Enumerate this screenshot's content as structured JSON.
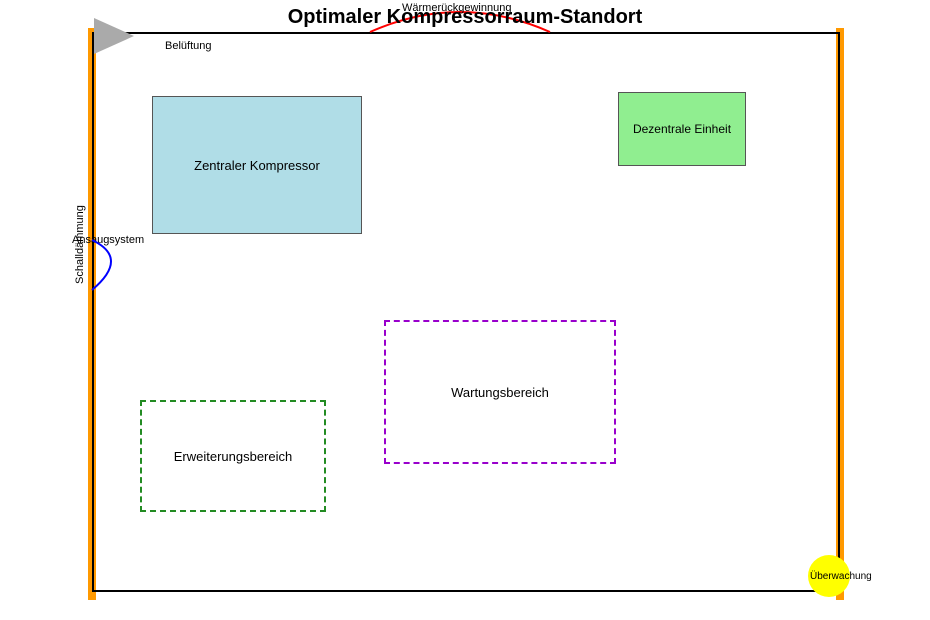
{
  "title": "Optimaler Kompressorraum-Standort",
  "labels": {
    "belueftung": "Belüftung",
    "waerme": "Wärmerückgewinnung",
    "ansaug": "Ansaugsystem",
    "schall": "Schalldämmung",
    "ueberwachung": "Überwachung"
  },
  "boxes": {
    "central": "Zentraler Kompressor",
    "dezentral": "Dezentrale Einheit",
    "wartung": "Wartungsbereich",
    "erweiterung": "Erweiterungsbereich"
  },
  "colors": {
    "orange": "#ff9900",
    "central_bg": "#b0dde7",
    "dezentral_bg": "#90ee90",
    "wartung_border": "#9900cc",
    "erweiterung_border": "#228b22",
    "circle": "#ffff00",
    "arrow": "#aaaaaa",
    "red_arc": "#ff0000",
    "blue_arc": "#0000ff"
  }
}
